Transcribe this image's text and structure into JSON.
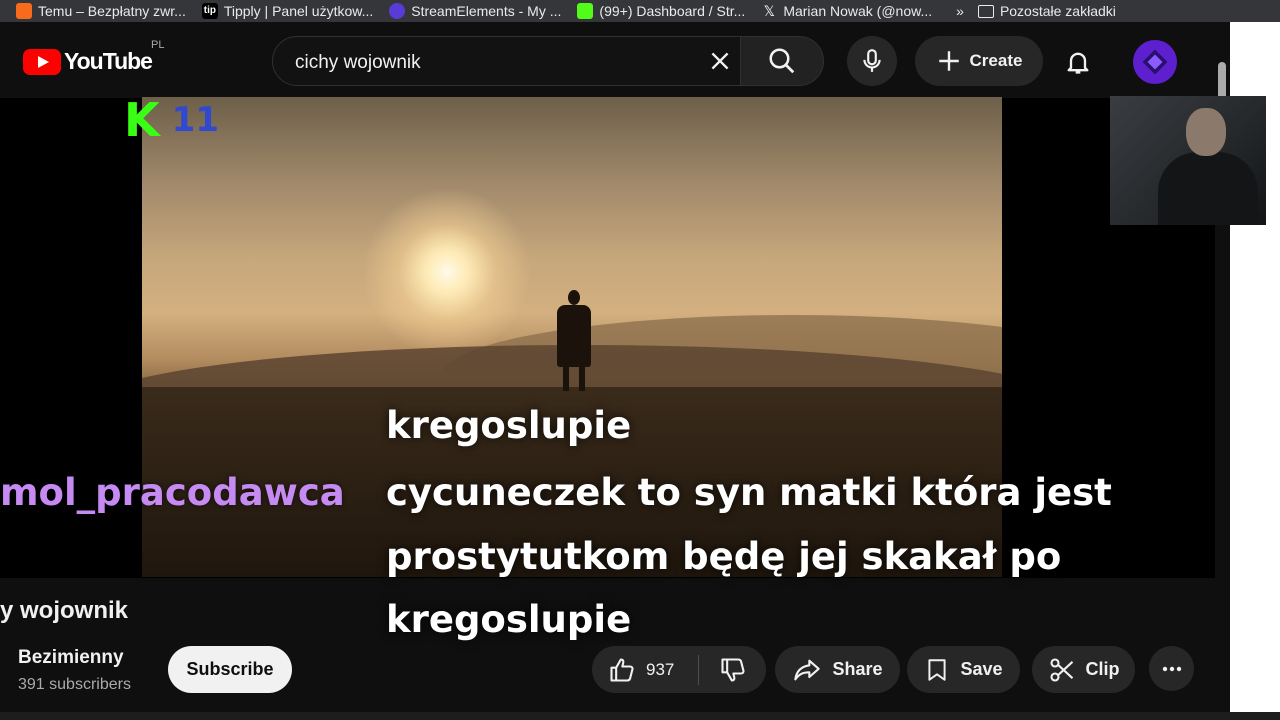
{
  "bookmarks": {
    "items": [
      {
        "label": "Temu – Bezpłatny zwr...",
        "icon": "temu-icon",
        "color": "#f86b1c"
      },
      {
        "label": "Tipply | Panel użytkow...",
        "icon": "tipply-icon",
        "color": "#000000"
      },
      {
        "label": "StreamElements - My ...",
        "icon": "streamelements-icon",
        "color": "#5b3bd6"
      },
      {
        "label": "(99+) Dashboard / Str...",
        "icon": "kick-icon",
        "color": "#53fc18"
      },
      {
        "label": "Marian Nowak (@now...",
        "icon": "x-icon",
        "color": "#000000"
      }
    ],
    "more_label": "»",
    "folder_label": "Pozostałe zakładki"
  },
  "header": {
    "logo_text": "YouTube",
    "country": "PL",
    "search_value": "cichy wojownik",
    "create_label": "Create",
    "icons": [
      "search-icon",
      "mic-icon",
      "bell-icon",
      "close-icon",
      "plus-icon"
    ],
    "accent": "#ff0000",
    "avatar_color": "#5e1fcf"
  },
  "overlay": {
    "k_logo": "K",
    "k_count": "11",
    "chat_username": "mol_pracodawca",
    "chat_lines": [
      "kregoslupie",
      "cycuneczek to syn matki która jest",
      "prostytutkom będę jej skakał po",
      "kregoslupie"
    ],
    "username_color": "#c68bf2",
    "k_color": "#39ff14",
    "count_color": "#3049d0"
  },
  "video": {
    "title": "y wojownik",
    "channel": "Bezimienny",
    "subscribers": "391 subscribers",
    "subscribe_label": "Subscribe",
    "likes": "937",
    "share_label": "Share",
    "save_label": "Save",
    "clip_label": "Clip"
  }
}
